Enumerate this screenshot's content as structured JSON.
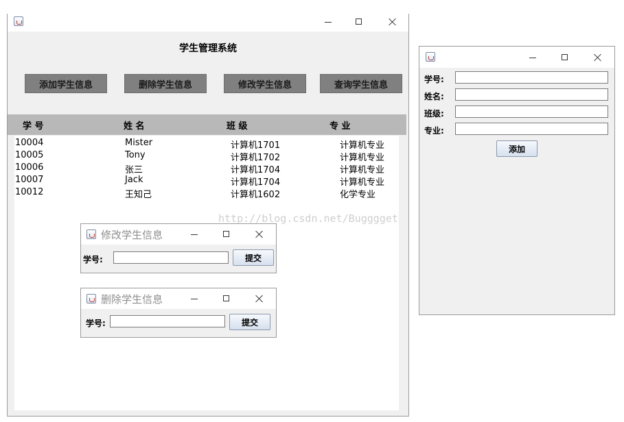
{
  "main_window": {
    "title": "学生管理系统",
    "buttons": [
      "添加学生信息",
      "删除学生信息",
      "修改学生信息",
      "查询学生信息"
    ],
    "columns": [
      "学 号",
      "姓 名",
      "班 级",
      "专 业"
    ],
    "rows": [
      [
        "10004",
        "Mister",
        "计算机1701",
        "计算机专业"
      ],
      [
        "10005",
        "Tony",
        "计算机1702",
        "计算机专业"
      ],
      [
        "10006",
        "张三",
        "计算机1704",
        "计算机专业"
      ],
      [
        "10007",
        "Jack",
        "计算机1704",
        "计算机专业"
      ],
      [
        "10012",
        "王知己",
        "计算机1602",
        "化学专业"
      ]
    ]
  },
  "modify_dialog": {
    "title": "修改学生信息",
    "label": "学号:",
    "value": "",
    "submit": "提交"
  },
  "delete_dialog": {
    "title": "删除学生信息",
    "label": "学号:",
    "value": "",
    "submit": "提交"
  },
  "add_dialog": {
    "fields": [
      {
        "label": "学号:",
        "value": ""
      },
      {
        "label": "姓名:",
        "value": ""
      },
      {
        "label": "班级:",
        "value": ""
      },
      {
        "label": "专业:",
        "value": ""
      }
    ],
    "submit": "添加"
  },
  "watermark": "http://blog.csdn.net/Bugggget",
  "icons": {
    "app": "java-cup-icon",
    "minimize": "minimize-icon",
    "maximize": "maximize-icon",
    "close": "close-icon"
  }
}
